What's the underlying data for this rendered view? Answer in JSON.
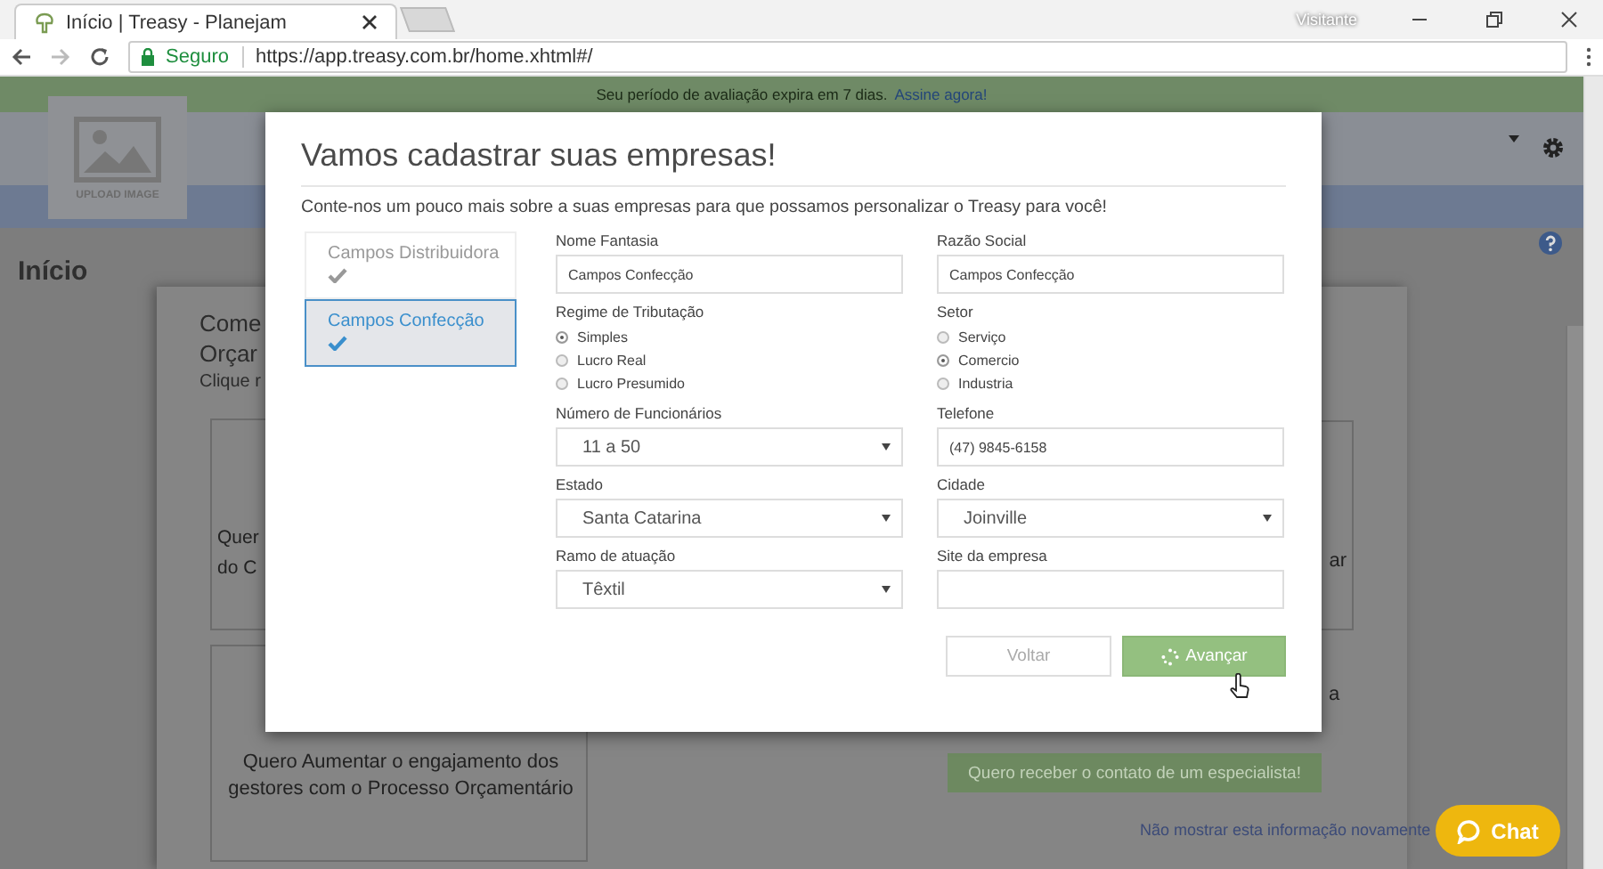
{
  "browser": {
    "tab": {
      "title": "Início | Treasy - Planejam",
      "selected": true
    },
    "profile": "Visitante",
    "address": {
      "security": "Seguro",
      "url": "https://app.treasy.com.br/home.xhtml#/"
    }
  },
  "banner": {
    "text": "Seu período de avaliação expira em 7 dias.",
    "link": "Assine agora!"
  },
  "header": {
    "logo_caption": "UPLOAD IMAGE"
  },
  "page": {
    "heading": "Início",
    "card": {
      "title_lines": [
        "Come",
        "Orçar"
      ],
      "hint": "Clique r",
      "option_1": [
        "Quer",
        "do C"
      ],
      "option_2": "Quero Aumentar o engajamento dos gestores com o Processo Orçamentário",
      "option_3": "ar",
      "option_4": "a",
      "cta": "Quero receber o contato de um especialista!",
      "dismiss": "Não mostrar esta informação novamente"
    }
  },
  "modal": {
    "title": "Vamos cadastrar suas empresas!",
    "subtitle": "Conte-nos um pouco mais sobre a suas empresas para que possamos personalizar o Treasy para você!",
    "companies": [
      {
        "name": "Campos Distribuidora",
        "selected": false,
        "done": true
      },
      {
        "name": "Campos Confecção",
        "selected": true,
        "done": true
      }
    ],
    "columns": [
      [
        {
          "kind": "text",
          "label": "Nome Fantasia",
          "value": "Campos Confecção"
        },
        {
          "kind": "radio",
          "label": "Regime de Tributação",
          "options": [
            {
              "label": "Simples",
              "selected": true
            },
            {
              "label": "Lucro Real",
              "selected": false
            },
            {
              "label": "Lucro Presumido",
              "selected": false
            }
          ]
        },
        {
          "kind": "select",
          "label": "Número de Funcionários",
          "value": "11 a 50"
        },
        {
          "kind": "select",
          "label": "Estado",
          "value": "Santa Catarina"
        },
        {
          "kind": "select",
          "label": "Ramo de atuação",
          "value": "Têxtil"
        }
      ],
      [
        {
          "kind": "text",
          "label": "Razão Social",
          "value": "Campos Confecção"
        },
        {
          "kind": "radio",
          "label": "Setor",
          "options": [
            {
              "label": "Serviço",
              "selected": false
            },
            {
              "label": "Comercio",
              "selected": true
            },
            {
              "label": "Industria",
              "selected": false
            }
          ]
        },
        {
          "kind": "text",
          "label": "Telefone",
          "value": "(47) 9845-6158"
        },
        {
          "kind": "select",
          "label": "Cidade",
          "value": "Joinville"
        },
        {
          "kind": "text",
          "label": "Site da empresa"
        }
      ]
    ],
    "buttons": [
      {
        "label": "Voltar",
        "kind": "secondary",
        "loading": false
      },
      {
        "label": "Avançar",
        "kind": "primary",
        "loading": true
      }
    ]
  },
  "chat": {
    "label": "Chat"
  }
}
